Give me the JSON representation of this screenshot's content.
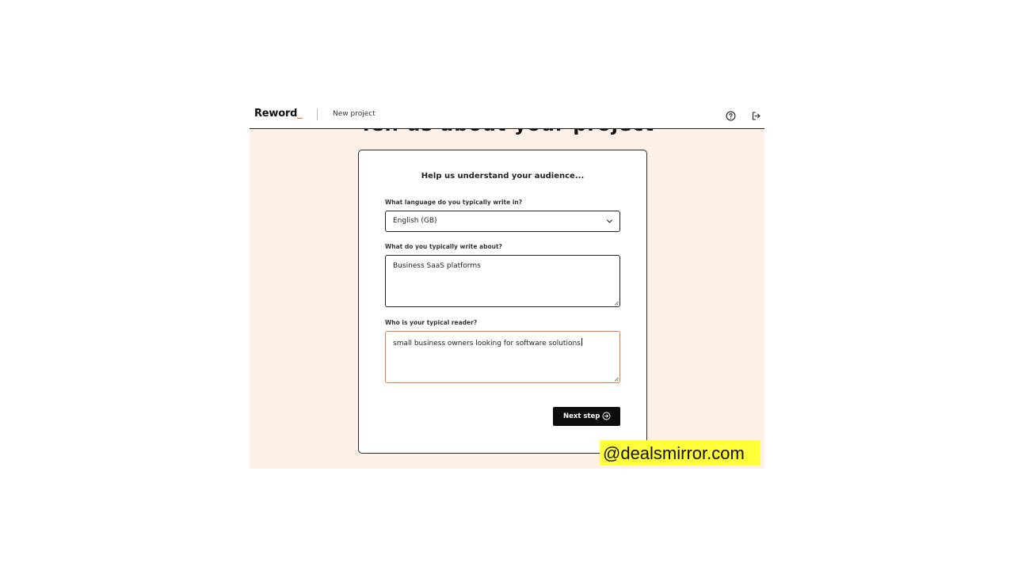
{
  "header": {
    "logo_text": "Reword",
    "logo_suffix": "_",
    "project_label": "New project",
    "help_icon": "help-circle-icon",
    "logout_icon": "logout-icon"
  },
  "background_heading": "Tell us about your project",
  "card": {
    "title": "Help us understand your audience...",
    "language": {
      "label": "What language do you typically write in?",
      "selected": "English (GB)"
    },
    "topic": {
      "label": "What do you typically write about?",
      "value": "Business SaaS platforms"
    },
    "reader": {
      "label": "Who is your typical reader?",
      "value": "small business owners looking for software solutions"
    },
    "next_button": {
      "label": "Next step",
      "icon": "arrow-right-circle-icon"
    }
  },
  "watermark": "@dealsmirror.com",
  "colors": {
    "accent": "#e8793a",
    "canvas": "#fdf1e7",
    "button": "#0d0d0d",
    "watermark_bg": "#ffff3a"
  }
}
